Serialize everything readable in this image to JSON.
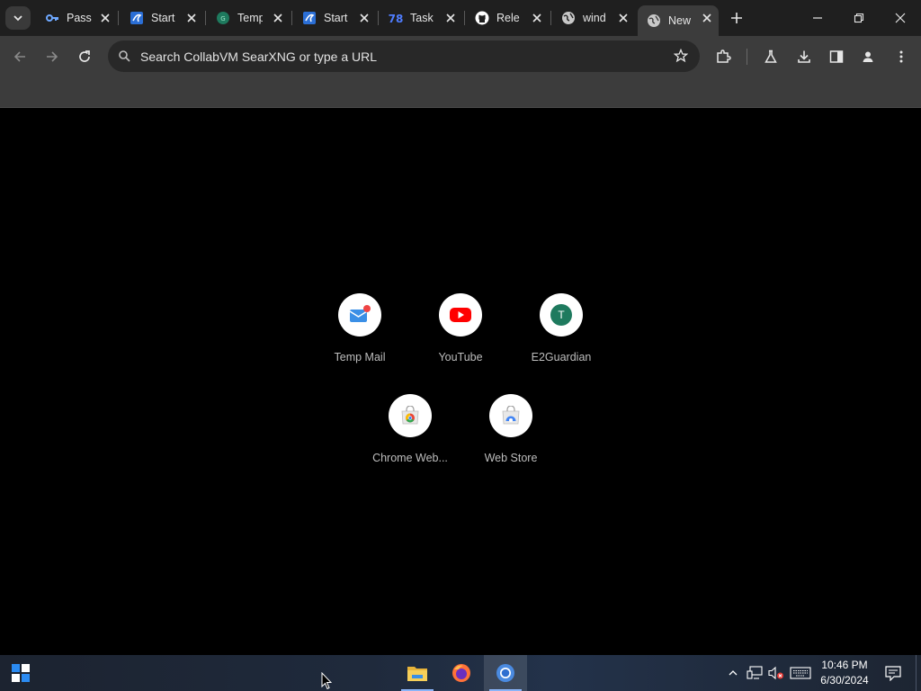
{
  "tabs": [
    {
      "title": "Pass",
      "icon": "key-icon"
    },
    {
      "title": "Start",
      "icon": "start-page-icon"
    },
    {
      "title": "Temp",
      "icon": "tempmail-icon"
    },
    {
      "title": "Start",
      "icon": "start-page-icon"
    },
    {
      "title": "Task",
      "icon": "task-icon"
    },
    {
      "title": "Rele",
      "icon": "github-icon"
    },
    {
      "title": "wind",
      "icon": "globe-icon"
    },
    {
      "title": "New",
      "icon": "globe-icon",
      "active": true
    }
  ],
  "omnibox": {
    "placeholder": "Search CollabVM SearXNG or type a URL"
  },
  "shortcuts": [
    {
      "label": "Temp Mail",
      "icon": "temp-mail-icon"
    },
    {
      "label": "YouTube",
      "icon": "youtube-icon"
    },
    {
      "label": "E2Guardian",
      "icon": "letter-t-icon",
      "letter": "T"
    },
    {
      "label": "Chrome Web...",
      "icon": "chrome-web-store-icon"
    },
    {
      "label": "Web Store",
      "icon": "web-store-icon"
    }
  ],
  "taskbar": {
    "apps": [
      {
        "name": "file-explorer-icon"
      },
      {
        "name": "firefox-icon"
      },
      {
        "name": "chrome-icon",
        "active": true
      }
    ]
  },
  "clock": {
    "time": "10:46 PM",
    "date": "6/30/2024"
  },
  "colors": {
    "tabstrip": "#1f1f1f",
    "toolbar": "#3c3c3c",
    "omnibox": "#282828",
    "content": "#000000",
    "youtube_red": "#ff0000",
    "e2guardian_green": "#1e7a5e"
  }
}
